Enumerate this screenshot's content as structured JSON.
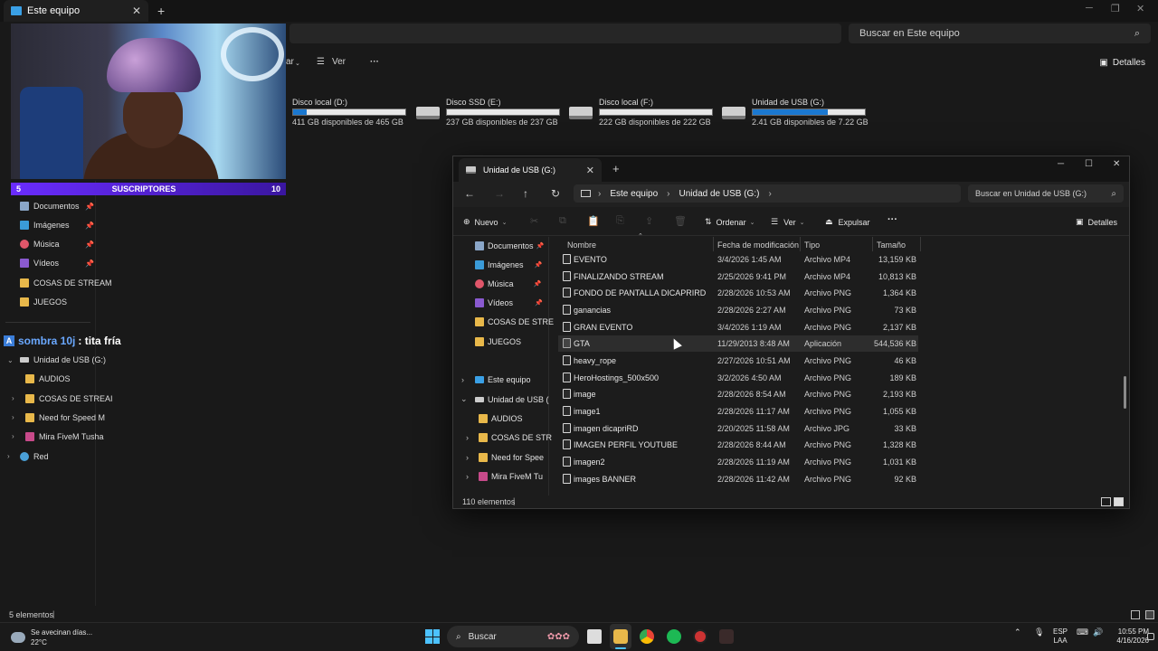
{
  "back_window": {
    "tab_title": "Este equipo",
    "search_placeholder": "Buscar en Este equipo",
    "toolbar": {
      "partial_label": "ar",
      "view_label": "Ver",
      "details_label": "Detalles"
    },
    "drives": [
      {
        "name": "Disco local (D:)",
        "free": "411 GB disponibles de 465 GB",
        "used_fraction": 0.12
      },
      {
        "name": "Disco SSD (E:)",
        "free": "237 GB disponibles de 237 GB",
        "used_fraction": 0.0
      },
      {
        "name": "Disco local (F:)",
        "free": "222 GB disponibles de 222 GB",
        "used_fraction": 0.0
      },
      {
        "name": "Unidad de USB (G:)",
        "free": "2.41 GB disponibles de 7.22 GB",
        "used_fraction": 0.67
      }
    ],
    "nav": {
      "documentos": "Documentos",
      "imagenes": "Imágenes",
      "musica": "Música",
      "videos": "Vídeos",
      "cosas": "COSAS DE STREAM",
      "juegos": "JUEGOS",
      "usb": "Unidad de USB (G:)",
      "audios": "AUDIOS",
      "cosas_usb": "COSAS DE STREAI",
      "nfs": "Need for Speed M",
      "fivem": "Mira FiveM Tusha",
      "red": "Red"
    },
    "status": "5 elementos"
  },
  "overlay": {
    "subs_left": "5",
    "subs_label": "SUSCRIPTORES",
    "subs_right": "10",
    "chat_user": "sombra 10j",
    "chat_text": ": tita fría"
  },
  "front_window": {
    "tab_title": "Unidad de USB (G:)",
    "breadcrumb": [
      "Este equipo",
      "Unidad de USB (G:)"
    ],
    "search_placeholder": "Buscar en Unidad de USB (G:)",
    "toolbar": {
      "new_label": "Nuevo",
      "sort_label": "Ordenar",
      "view_label": "Ver",
      "eject_label": "Expulsar",
      "details_label": "Detalles"
    },
    "nav": {
      "documentos": "Documentos",
      "imagenes": "Imágenes",
      "musica": "Música",
      "videos": "Vídeos",
      "cosas": "COSAS DE STRE",
      "juegos": "JUEGOS",
      "este_equipo": "Este equipo",
      "usb": "Unidad de USB (",
      "audios": "AUDIOS",
      "cosas_usb": "COSAS DE STR",
      "nfs": "Need for Spee",
      "fivem": "Mira FiveM Tu"
    },
    "columns": {
      "name": "Nombre",
      "date": "Fecha de modificación",
      "type": "Tipo",
      "size": "Tamaño"
    },
    "files": [
      {
        "name": "EVENTO",
        "date": "3/4/2026 1:45 AM",
        "type": "Archivo MP4",
        "size": "13,159 KB"
      },
      {
        "name": "FINALIZANDO STREAM",
        "date": "2/25/2026 9:41 PM",
        "type": "Archivo MP4",
        "size": "10,813 KB"
      },
      {
        "name": "FONDO DE PANTALLA DICAPRIRD",
        "date": "2/28/2026 10:53 AM",
        "type": "Archivo PNG",
        "size": "1,364 KB"
      },
      {
        "name": "ganancias",
        "date": "2/28/2026 2:27 AM",
        "type": "Archivo PNG",
        "size": "73 KB"
      },
      {
        "name": "GRAN EVENTO",
        "date": "3/4/2026 1:19 AM",
        "type": "Archivo PNG",
        "size": "2,137 KB"
      },
      {
        "name": "GTA",
        "date": "11/29/2013 8:48 AM",
        "type": "Aplicación",
        "size": "544,536 KB"
      },
      {
        "name": "heavy_rope",
        "date": "2/27/2026 10:51 AM",
        "type": "Archivo PNG",
        "size": "46 KB"
      },
      {
        "name": "HeroHostings_500x500",
        "date": "3/2/2026 4:50 AM",
        "type": "Archivo PNG",
        "size": "189 KB"
      },
      {
        "name": "image",
        "date": "2/28/2026 8:54 AM",
        "type": "Archivo PNG",
        "size": "2,193 KB"
      },
      {
        "name": "image1",
        "date": "2/28/2026 11:17 AM",
        "type": "Archivo PNG",
        "size": "1,055 KB"
      },
      {
        "name": "imagen dicapriRD",
        "date": "2/20/2025 11:58 AM",
        "type": "Archivo JPG",
        "size": "33 KB"
      },
      {
        "name": "IMAGEN PERFIL YOUTUBE",
        "date": "2/28/2026 8:44 AM",
        "type": "Archivo PNG",
        "size": "1,328 KB"
      },
      {
        "name": "imagen2",
        "date": "2/28/2026 11:19 AM",
        "type": "Archivo PNG",
        "size": "1,031 KB"
      },
      {
        "name": "images BANNER",
        "date": "2/28/2026 11:42 AM",
        "type": "Archivo PNG",
        "size": "92 KB"
      }
    ],
    "status": "110 elementos"
  },
  "taskbar": {
    "weather_text": "Se avecinan días...",
    "weather_temp": "22°C",
    "search_label": "Buscar",
    "lang_1": "ESP",
    "lang_2": "LAA",
    "time": "10:55 PM",
    "date": "4/16/2026"
  }
}
